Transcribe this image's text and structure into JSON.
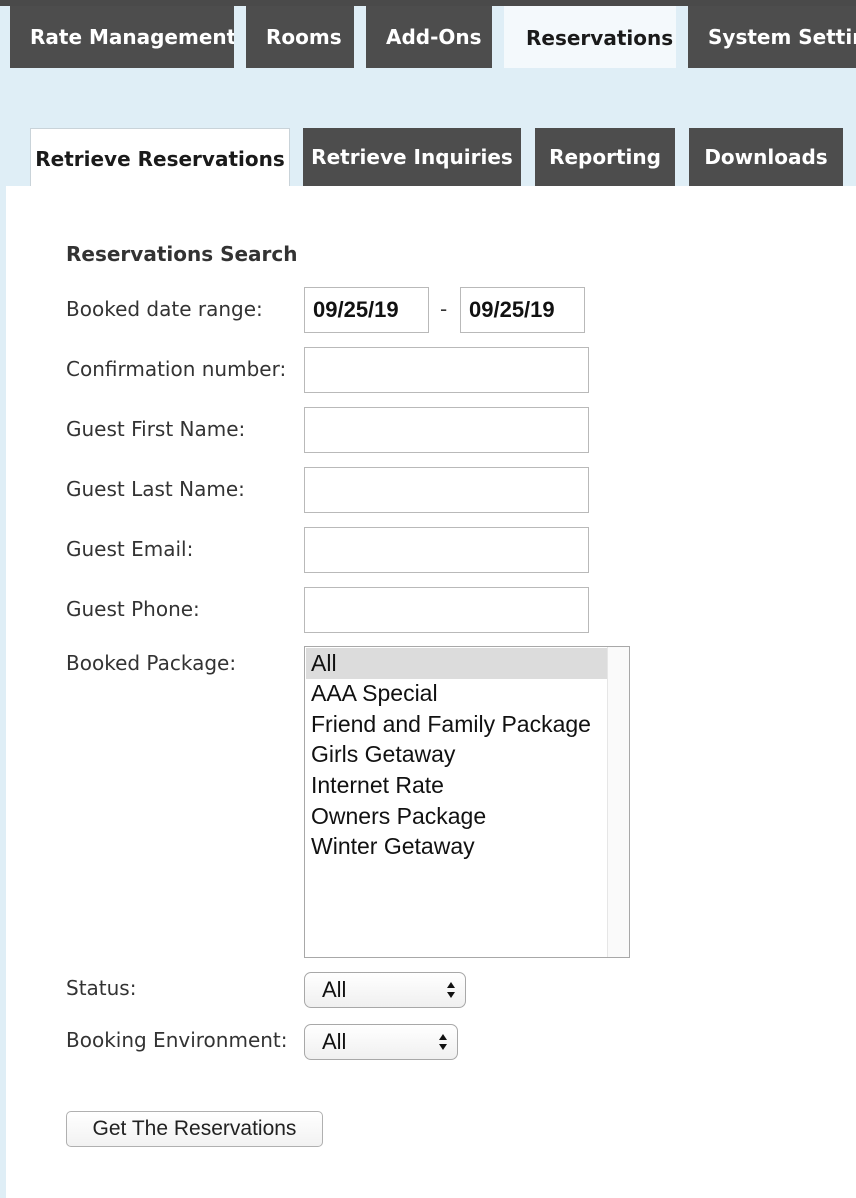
{
  "top_nav": {
    "tabs": [
      {
        "label": "Rate Management"
      },
      {
        "label": "Rooms"
      },
      {
        "label": "Add-Ons"
      },
      {
        "label": "Reservations",
        "active": true
      },
      {
        "label": "System Settings"
      }
    ]
  },
  "sub_nav": {
    "tabs": [
      {
        "label": "Retrieve Reservations",
        "active": true
      },
      {
        "label": "Retrieve Inquiries"
      },
      {
        "label": "Reporting"
      },
      {
        "label": "Downloads"
      }
    ]
  },
  "form": {
    "title": "Reservations Search",
    "booked_date_range": {
      "label": "Booked date range:",
      "from": "09/25/19",
      "separator": "-",
      "to": "09/25/19"
    },
    "confirmation_number": {
      "label": "Confirmation number:",
      "value": ""
    },
    "guest_first_name": {
      "label": "Guest First Name:",
      "value": ""
    },
    "guest_last_name": {
      "label": "Guest Last Name:",
      "value": ""
    },
    "guest_email": {
      "label": "Guest Email:",
      "value": ""
    },
    "guest_phone": {
      "label": "Guest Phone:",
      "value": ""
    },
    "booked_package": {
      "label": "Booked Package:",
      "options": [
        "All",
        "AAA Special",
        "Friend and Family Package",
        "Girls Getaway",
        "Internet Rate",
        "Owners Package",
        "Winter Getaway"
      ],
      "selected": "All"
    },
    "status": {
      "label": "Status:",
      "value": "All"
    },
    "booking_environment": {
      "label": "Booking Environment:",
      "value": "All"
    },
    "submit_label": "Get The Reservations"
  },
  "colors": {
    "tab_dark": "#4d4d4d",
    "page_bg": "#dfeef6",
    "panel_bg": "#ffffff",
    "selected_option": "#dcdcdc"
  }
}
